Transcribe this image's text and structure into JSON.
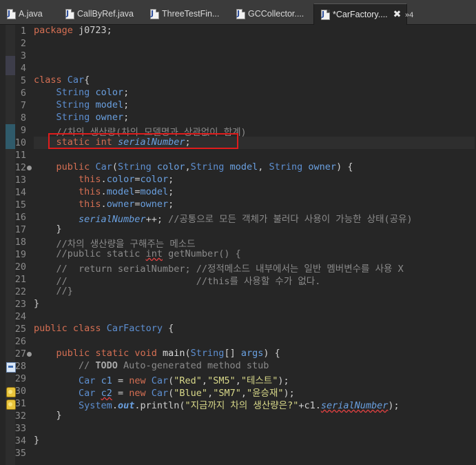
{
  "tabs": [
    {
      "label": "A.java"
    },
    {
      "label": "CallByRef.java"
    },
    {
      "label": "ThreeTestFin..."
    },
    {
      "label": "GCCollector...."
    },
    {
      "label": "*CarFactory...."
    },
    {
      "label": "»4"
    }
  ],
  "active_tab_index": 4,
  "close_glyph": "✖",
  "editor": {
    "line_numbers": [
      "1",
      "2",
      "3",
      "4",
      "5",
      "6",
      "7",
      "8",
      "9",
      "10",
      "11",
      "12",
      "13",
      "14",
      "15",
      "16",
      "17",
      "18",
      "19",
      "20",
      "21",
      "22",
      "23",
      "24",
      "25",
      "26",
      "27",
      "28",
      "29",
      "30",
      "31",
      "32",
      "33",
      "34",
      "35"
    ],
    "lines": {
      "l1": [
        "package",
        " j0723;"
      ],
      "l5": [
        "class",
        " ",
        "Car",
        "{"
      ],
      "l6": [
        "    ",
        "String",
        " ",
        "color",
        ";"
      ],
      "l7": [
        "    ",
        "String",
        " ",
        "model",
        ";"
      ],
      "l8": [
        "    ",
        "String",
        " ",
        "owner",
        ";"
      ],
      "l9": [
        "    //차의 생산량(차의 모델명과 상관없이 합계)"
      ],
      "l10": [
        "    ",
        "static",
        " ",
        "int",
        " ",
        "serialNumber",
        ";"
      ],
      "l12": [
        "    ",
        "public",
        " ",
        "Car",
        "(",
        "String",
        " ",
        "color",
        ",",
        "String",
        " ",
        "model",
        ", ",
        "String",
        " ",
        "owner",
        ") {"
      ],
      "l13": [
        "        ",
        "this",
        ".",
        "color",
        "=",
        "color",
        ";"
      ],
      "l14": [
        "        ",
        "this",
        ".",
        "model",
        "=",
        "model",
        ";"
      ],
      "l15": [
        "        ",
        "this",
        ".",
        "owner",
        "=",
        "owner",
        ";"
      ],
      "l16": [
        "        ",
        "serialNumber",
        "++; ",
        "//공통으로 모든 객체가 불러다 사용이 가능한 상태(공유)"
      ],
      "l17": [
        "    }"
      ],
      "l18": [
        "    //차의 생산량을 구해주는 메소드"
      ],
      "l19": [
        "    //public static ",
        "int",
        " getNumber() {"
      ],
      "l20": [
        "    //  return serialNumber; //정적메소드 내부에서는 일반 멤버변수를 사용 X"
      ],
      "l21": [
        "    //                       //this를 사용할 수가 없다."
      ],
      "l22": [
        "    //}"
      ],
      "l23": [
        "}"
      ],
      "l25": [
        "public",
        " ",
        "class",
        " ",
        "CarFactory",
        " {"
      ],
      "l27": [
        "    ",
        "public",
        " ",
        "static",
        " ",
        "void",
        " ",
        "main",
        "(",
        "String",
        "[] ",
        "args",
        ") {"
      ],
      "l28": [
        "        // ",
        "TODO",
        " Auto-generated method stub"
      ],
      "l29": [
        "        ",
        "Car",
        " ",
        "c1",
        " = ",
        "new",
        " ",
        "Car",
        "(",
        "\"Red\"",
        ",",
        "\"SM5\"",
        ",",
        "\"테스트\"",
        ");"
      ],
      "l30": [
        "        ",
        "Car",
        " ",
        "c2",
        " = ",
        "new",
        " ",
        "Car",
        "(",
        "\"Blue\"",
        ",",
        "\"SM7\"",
        ",",
        "\"윤승재\"",
        ");"
      ],
      "l31": [
        "        ",
        "System",
        ".",
        "out",
        ".println(",
        "\"지금까지 차의 생산량은?\"",
        "+c1.",
        "serialNumber",
        ");"
      ],
      "l32": [
        "    }"
      ],
      "l34": [
        "}"
      ]
    }
  },
  "colors": {
    "keyword": "#d56f53",
    "type": "#5d8fd1",
    "field": "#6aa0e0",
    "string": "#d9d98a",
    "comment": "#8b8b8b",
    "highlight_box": "#e01c1c"
  }
}
